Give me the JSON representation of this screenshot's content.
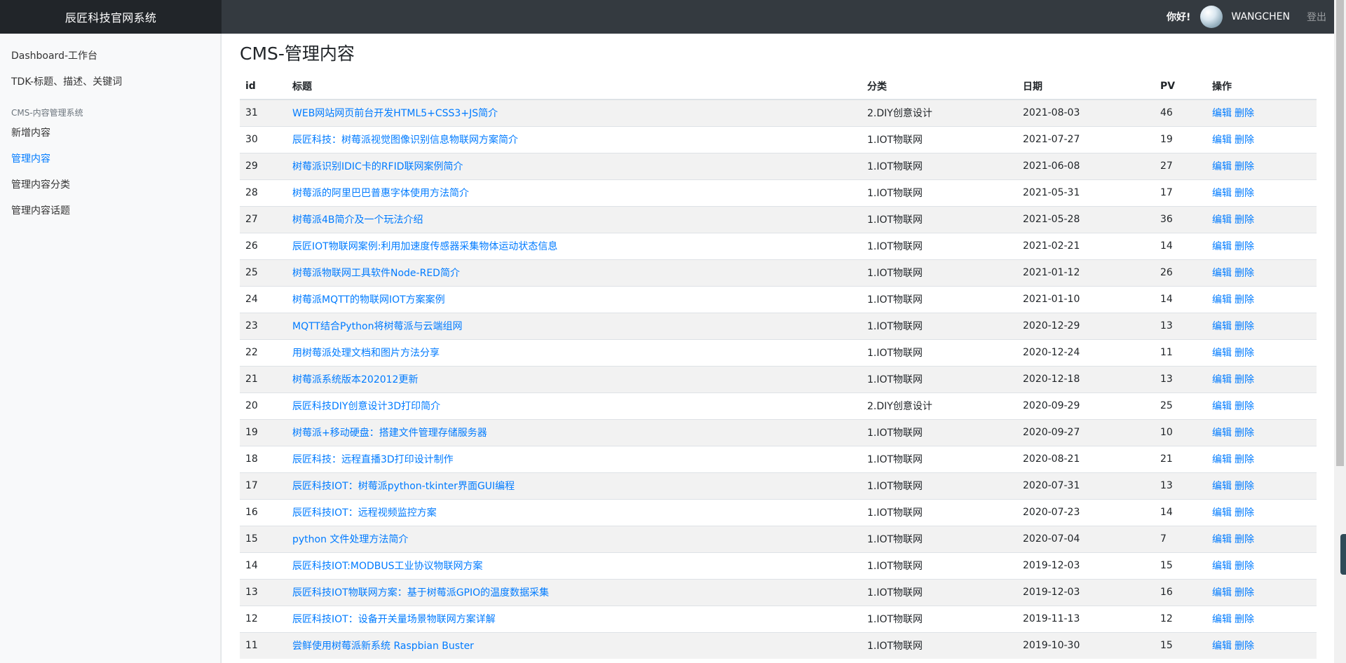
{
  "header": {
    "brand": "辰匠科技官网系统",
    "greeting": "你好!",
    "username": "WANGCHEN",
    "logout": "登出"
  },
  "sidebar": {
    "items_top": [
      {
        "label": "Dashboard-工作台"
      },
      {
        "label": "TDK-标题、描述、关键词"
      }
    ],
    "group_label": "CMS-内容管理系统",
    "items_group": [
      {
        "label": "新增内容",
        "active": false
      },
      {
        "label": "管理内容",
        "active": true
      },
      {
        "label": "管理内容分类",
        "active": false
      },
      {
        "label": "管理内容话题",
        "active": false
      }
    ]
  },
  "main": {
    "title": "CMS-管理内容",
    "columns": [
      "id",
      "标题",
      "分类",
      "日期",
      "PV",
      "操作"
    ],
    "edit_label": "编辑",
    "delete_label": "删除",
    "rows": [
      {
        "id": "31",
        "title": "WEB网站网页前台开发HTML5+CSS3+JS简介",
        "category": "2.DIY创意设计",
        "date": "2021-08-03",
        "pv": "46"
      },
      {
        "id": "30",
        "title": "辰匠科技：树莓派视觉图像识别信息物联网方案简介",
        "category": "1.IOT物联网",
        "date": "2021-07-27",
        "pv": "19"
      },
      {
        "id": "29",
        "title": "树莓派识别IDIC卡的RFID联网案例简介",
        "category": "1.IOT物联网",
        "date": "2021-06-08",
        "pv": "27"
      },
      {
        "id": "28",
        "title": "树莓派的阿里巴巴普惠字体使用方法简介",
        "category": "1.IOT物联网",
        "date": "2021-05-31",
        "pv": "17"
      },
      {
        "id": "27",
        "title": "树莓派4B简介及一个玩法介绍",
        "category": "1.IOT物联网",
        "date": "2021-05-28",
        "pv": "36"
      },
      {
        "id": "26",
        "title": "辰匠IOT物联网案例:利用加速度传感器采集物体运动状态信息",
        "category": "1.IOT物联网",
        "date": "2021-02-21",
        "pv": "14"
      },
      {
        "id": "25",
        "title": "树莓派物联网工具软件Node-RED简介",
        "category": "1.IOT物联网",
        "date": "2021-01-12",
        "pv": "26"
      },
      {
        "id": "24",
        "title": "树莓派MQTT的物联网IOT方案案例",
        "category": "1.IOT物联网",
        "date": "2021-01-10",
        "pv": "14"
      },
      {
        "id": "23",
        "title": "MQTT结合Python将树莓派与云端组网",
        "category": "1.IOT物联网",
        "date": "2020-12-29",
        "pv": "13"
      },
      {
        "id": "22",
        "title": "用树莓派处理文档和图片方法分享",
        "category": "1.IOT物联网",
        "date": "2020-12-24",
        "pv": "11"
      },
      {
        "id": "21",
        "title": "树莓派系统版本202012更新",
        "category": "1.IOT物联网",
        "date": "2020-12-18",
        "pv": "13"
      },
      {
        "id": "20",
        "title": "辰匠科技DIY创意设计3D打印简介",
        "category": "2.DIY创意设计",
        "date": "2020-09-29",
        "pv": "25"
      },
      {
        "id": "19",
        "title": "树莓派+移动硬盘：搭建文件管理存储服务器",
        "category": "1.IOT物联网",
        "date": "2020-09-27",
        "pv": "10"
      },
      {
        "id": "18",
        "title": "辰匠科技：远程直播3D打印设计制作",
        "category": "1.IOT物联网",
        "date": "2020-08-21",
        "pv": "21"
      },
      {
        "id": "17",
        "title": "辰匠科技IOT：树莓派python-tkinter界面GUI编程",
        "category": "1.IOT物联网",
        "date": "2020-07-31",
        "pv": "13"
      },
      {
        "id": "16",
        "title": "辰匠科技IOT：远程视频监控方案",
        "category": "1.IOT物联网",
        "date": "2020-07-23",
        "pv": "14"
      },
      {
        "id": "15",
        "title": "python 文件处理方法简介",
        "category": "1.IOT物联网",
        "date": "2020-07-04",
        "pv": "7"
      },
      {
        "id": "14",
        "title": "辰匠科技IOT:MODBUS工业协议物联网方案",
        "category": "1.IOT物联网",
        "date": "2019-12-03",
        "pv": "15"
      },
      {
        "id": "13",
        "title": "辰匠科技IOT物联网方案：基于树莓派GPIO的温度数据采集",
        "category": "1.IOT物联网",
        "date": "2019-12-03",
        "pv": "16"
      },
      {
        "id": "12",
        "title": "辰匠科技IOT：设备开关量场景物联网方案详解",
        "category": "1.IOT物联网",
        "date": "2019-11-13",
        "pv": "12"
      },
      {
        "id": "11",
        "title": "尝鲜使用树莓派新系统 Raspbian Buster",
        "category": "1.IOT物联网",
        "date": "2019-10-30",
        "pv": "15"
      }
    ]
  }
}
